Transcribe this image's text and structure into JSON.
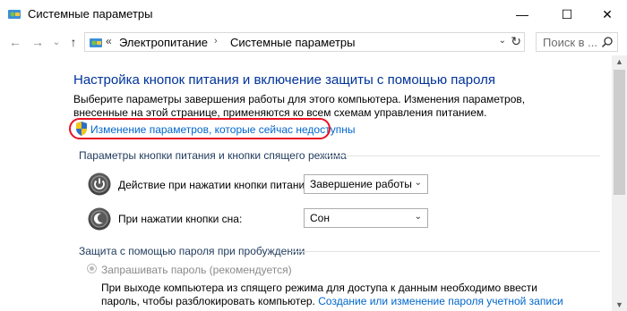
{
  "window": {
    "title": "Системные параметры",
    "minimize_glyph": "—",
    "maximize_glyph": "☐",
    "close_glyph": "✕"
  },
  "nav": {
    "back_glyph": "←",
    "forward_glyph": "→",
    "dropdown_glyph": "⌄",
    "up_glyph": "↑",
    "chevron": "«",
    "breadcrumb": [
      "Электропитание",
      "Системные параметры"
    ],
    "sep_glyph": "›",
    "address_dropdown_glyph": "⌄",
    "refresh_glyph": "↻",
    "search_placeholder": "Поиск в ..."
  },
  "main": {
    "heading": "Настройка кнопок питания и включение защиты с помощью пароля",
    "description": "Выберите параметры завершения работы для этого компьютера. Изменения параметров, внесенные на этой странице, применяются ко всем схемам управления питанием.",
    "change_settings_link": "Изменение параметров, которые сейчас недоступны",
    "power_section_title": "Параметры кнопки питания и кнопки спящего режима",
    "power_button_label": "Действие при нажатии кнопки питания:",
    "power_button_value": "Завершение работы",
    "sleep_button_label": "При нажатии кнопки сна:",
    "sleep_button_value": "Сон",
    "select_arrow_glyph": "⌄",
    "password_section_title": "Защита с помощью пароля при пробуждении",
    "require_password_label": "Запрашивать пароль (рекомендуется)",
    "require_password_desc": "При выходе компьютера из спящего режима для доступа к данным необходимо ввести пароль, чтобы разблокировать компьютер.",
    "password_link": "Создание или изменение пароля учетной записи"
  },
  "scroll": {
    "up_glyph": "▲",
    "down_glyph": "▼"
  },
  "colors": {
    "heading": "#003399",
    "link": "#0066cc",
    "highlight": "#e81123"
  }
}
